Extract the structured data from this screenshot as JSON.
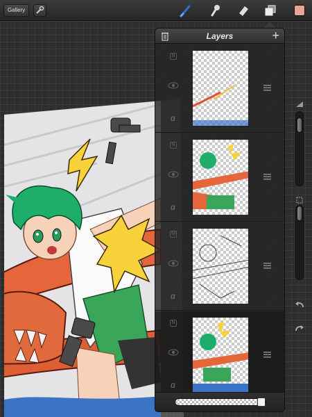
{
  "toolbar": {
    "gallery_label": "Gallery",
    "tools": [
      "wrench-icon",
      "brush-icon",
      "smudge-icon",
      "eraser-icon",
      "layers-icon"
    ],
    "active_tool": "brush-icon",
    "active_color": "#e8a592",
    "brush_color": "#2b6fd6"
  },
  "layers_panel": {
    "title": "Layers",
    "layers": [
      {
        "blend": "N",
        "alpha": "α",
        "kind": "effects"
      },
      {
        "blend": "N",
        "alpha": "α",
        "kind": "colors"
      },
      {
        "blend": "M",
        "alpha": "α",
        "kind": "lineart"
      },
      {
        "blend": "N",
        "alpha": "α",
        "kind": "background",
        "selected": true
      }
    ],
    "opacity": 1.0
  },
  "side_controls": {
    "brush_size": 0.1,
    "brush_opacity": 0.0
  }
}
